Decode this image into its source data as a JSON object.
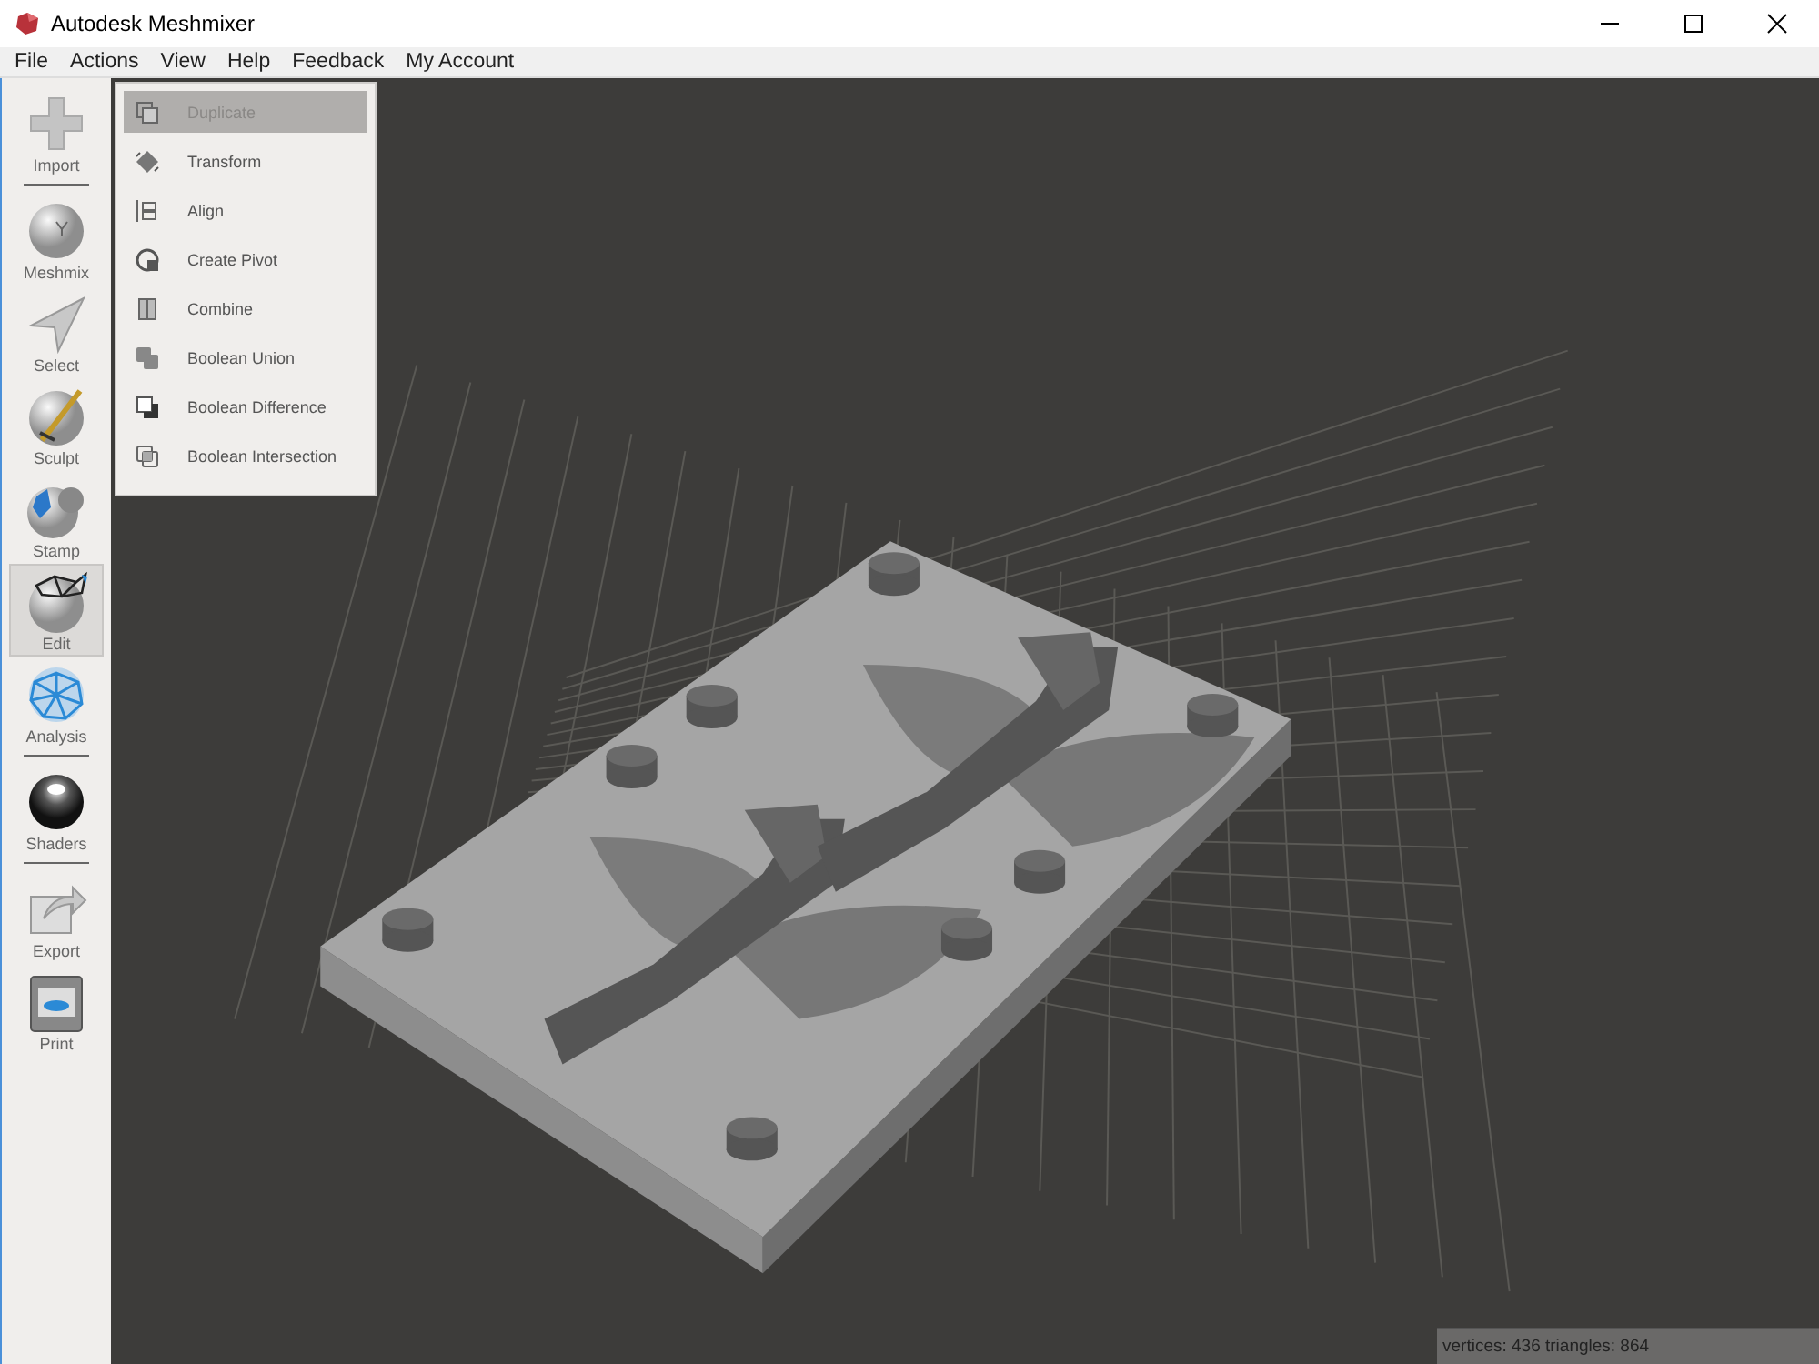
{
  "window": {
    "title": "Autodesk Meshmixer"
  },
  "menu": [
    "File",
    "Actions",
    "View",
    "Help",
    "Feedback",
    "My Account"
  ],
  "toolbar": [
    {
      "label": "Import",
      "selected": false,
      "separator_after": true
    },
    {
      "label": "Meshmix",
      "selected": false,
      "separator_after": false
    },
    {
      "label": "Select",
      "selected": false,
      "separator_after": false
    },
    {
      "label": "Sculpt",
      "selected": false,
      "separator_after": false
    },
    {
      "label": "Stamp",
      "selected": false,
      "separator_after": false
    },
    {
      "label": "Edit",
      "selected": true,
      "separator_after": false
    },
    {
      "label": "Analysis",
      "selected": false,
      "separator_after": true
    },
    {
      "label": "Shaders",
      "selected": false,
      "separator_after": true
    },
    {
      "label": "Export",
      "selected": false,
      "separator_after": false
    },
    {
      "label": "Print",
      "selected": false,
      "separator_after": false
    }
  ],
  "edit_menu": [
    {
      "label": "Duplicate",
      "selected": true
    },
    {
      "label": "Transform",
      "selected": false
    },
    {
      "label": "Align",
      "selected": false
    },
    {
      "label": "Create Pivot",
      "selected": false
    },
    {
      "label": "Combine",
      "selected": false
    },
    {
      "label": "Boolean Union",
      "selected": false
    },
    {
      "label": "Boolean Difference",
      "selected": false
    },
    {
      "label": "Boolean Intersection",
      "selected": false
    }
  ],
  "status_bar": "vertices: 436 triangles: 864"
}
